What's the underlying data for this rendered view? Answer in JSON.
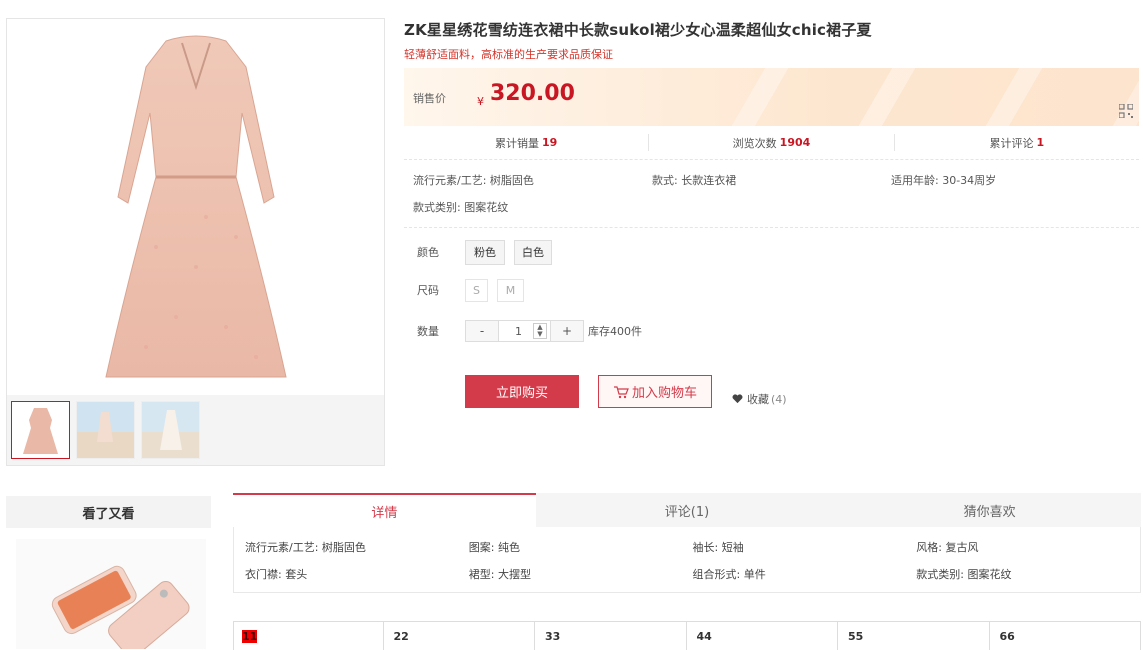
{
  "product": {
    "title": "ZK星星绣花雪纺连衣裙中长款sukol裙少女心温柔超仙女chic裙子夏",
    "subtitle": "轻薄舒适面料，高标准的生产要求品质保证",
    "price_label": "销售价",
    "currency": "¥",
    "price": "320.00"
  },
  "stats": [
    {
      "label": "累计销量",
      "value": "19"
    },
    {
      "label": "浏览次数",
      "value": "1904"
    },
    {
      "label": "累计评论",
      "value": "1"
    }
  ],
  "attributes": [
    "流行元素/工艺: 树脂固色",
    "款式: 长款连衣裙",
    "适用年龄: 30-34周岁",
    "款式类别: 图案花纹"
  ],
  "options": {
    "color_label": "颜色",
    "colors": [
      "粉色",
      "白色"
    ],
    "size_label": "尺码",
    "sizes": [
      "S",
      "M"
    ],
    "qty_label": "数量",
    "minus": "-",
    "qty": "1",
    "plus": "+",
    "stock": "库存400件"
  },
  "actions": {
    "buy": "立即购买",
    "cart": "加入购物车",
    "fav": "收藏",
    "fav_count": "(4)"
  },
  "sidebar": {
    "title": "看了又看"
  },
  "tabs": [
    "详情",
    "评论(1)",
    "猜你喜欢"
  ],
  "details": [
    [
      "流行元素/工艺: 树脂固色",
      "图案: 纯色",
      "袖长: 短袖",
      "风格: 复古风"
    ],
    [
      "衣门襟: 套头",
      "裙型: 大摆型",
      "组合形式: 单件",
      "款式类别: 图案花纹"
    ]
  ],
  "size_table": [
    "11",
    "22",
    "33",
    "44",
    "55",
    "66"
  ],
  "colors": {
    "accent": "#d43b4a",
    "price": "#c81623"
  }
}
